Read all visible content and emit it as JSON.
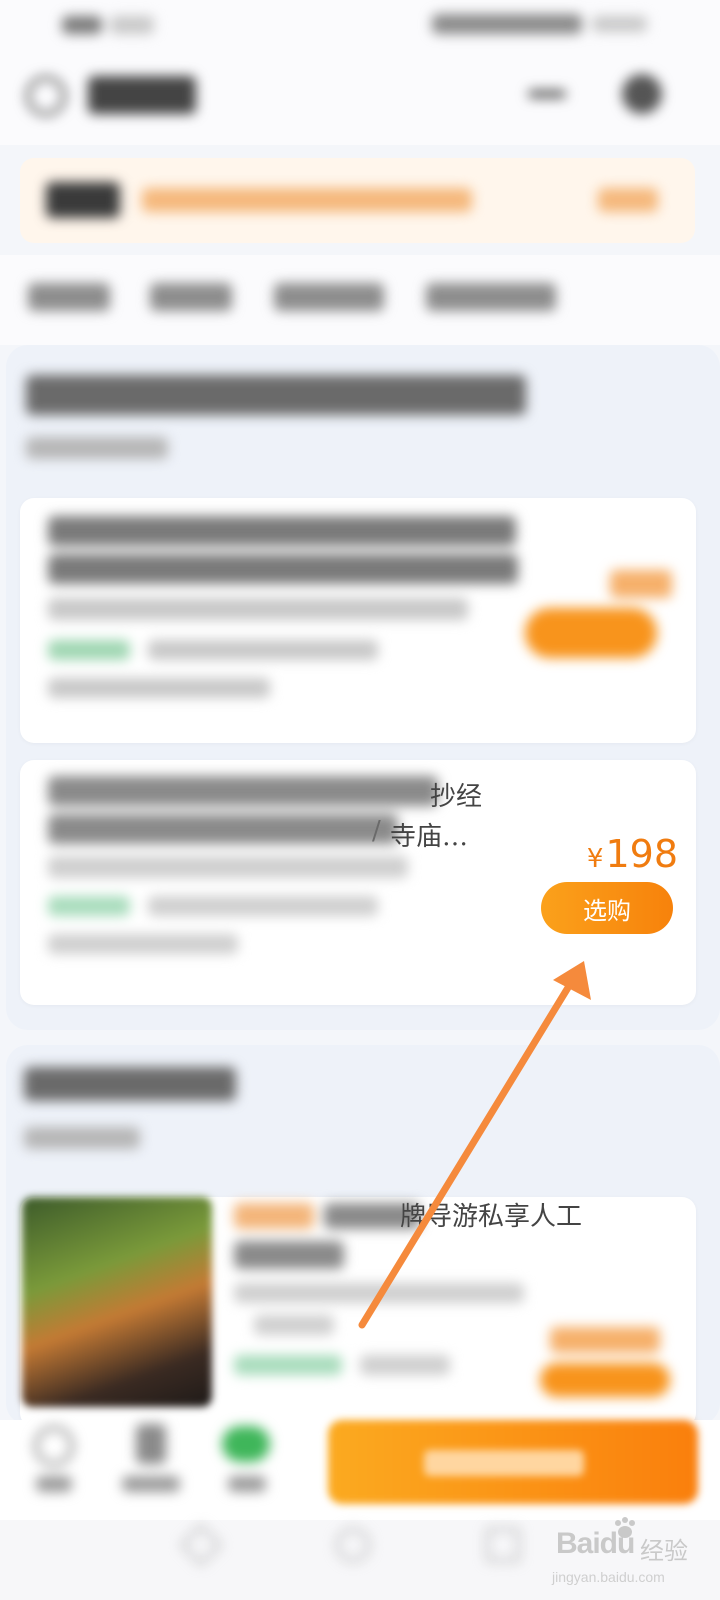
{
  "card_item_2": {
    "title_visible": "寺庙…",
    "title_line1_visible": "抄经",
    "title_char_visible": "/",
    "price_currency": "¥",
    "price_value": "198",
    "buy_label": "选购"
  },
  "section_2": {
    "card_title_visible": "牌导游私享人工"
  },
  "watermark": {
    "logo_text": "Baidu",
    "logo_suffix": "经验",
    "url": "jingyan.baidu.com"
  },
  "colors": {
    "accent_orange": "#f7820b",
    "price_orange": "#f07c10",
    "arrow_orange": "#f58a3c"
  },
  "icons": [
    "back-icon",
    "menu-icon",
    "home-nav-icon",
    "recent-nav-icon",
    "back-nav-icon",
    "wechat-icon",
    "edit-icon",
    "service-icon"
  ]
}
